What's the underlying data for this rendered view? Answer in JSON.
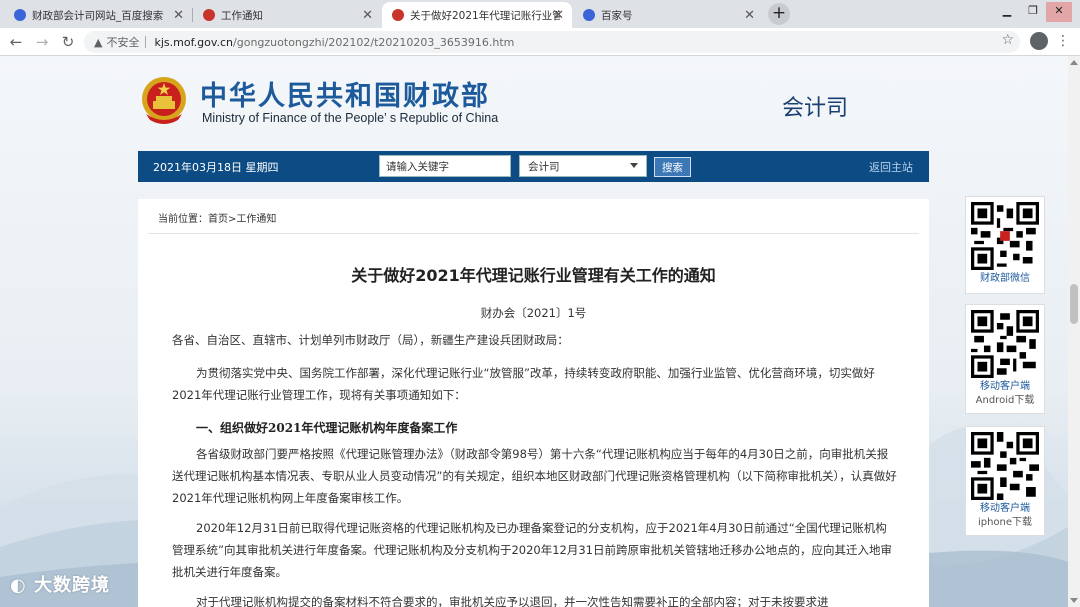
{
  "browser": {
    "tabs": [
      {
        "title": "财政部会计司网站_百度搜索",
        "active": false
      },
      {
        "title": "工作通知",
        "active": false
      },
      {
        "title": "关于做好2021年代理记账行业管",
        "active": true
      },
      {
        "title": "百家号",
        "active": false
      }
    ],
    "new_tab": "+",
    "security_label": "不安全",
    "url_host": "kjs.mof.gov.cn",
    "url_path": "/gongzuotongzhi/202102/t20210203_3653916.htm"
  },
  "site": {
    "name_cn": "中华人民共和国财政部",
    "name_en": "Ministry of Finance of the People’ s Republic of China",
    "dept": "会计司"
  },
  "toolbar": {
    "date": "2021年03月18日  星期四",
    "search_placeholder": "请输入关键字",
    "scope": "会计司",
    "search_button": "搜索",
    "back_home": "返回主站"
  },
  "article": {
    "breadcrumb": "当前位置：首页>工作通知",
    "title": "关于做好2021年代理记账行业管理有关工作的通知",
    "doc_no": "财办会〔2021〕1号",
    "salutation": "各省、自治区、直辖市、计划单列市财政厅（局），新疆生产建设兵团财政局：",
    "p1": "为贯彻落实党中央、国务院工作部署，深化代理记账行业“放管服”改革，持续转变政府职能、加强行业监管、优化营商环境，切实做好2021年代理记账行业管理工作，现将有关事项通知如下：",
    "h1": "一、组织做好2021年代理记账机构年度备案工作",
    "p2": "各省级财政部门要严格按照《代理记账管理办法》（财政部令第98号）第十六条“代理记账机构应当于每年的4月30日之前，向审批机关报送代理记账机构基本情况表、专职从业人员变动情况”的有关规定，组织本地区财政部门代理记账资格管理机构（以下简称审批机关），认真做好2021年代理记账机构网上年度备案审核工作。",
    "p3": "2020年12月31日前已取得代理记账资格的代理记账机构及已办理备案登记的分支机构，应于2021年4月30日前通过“全国代理记账机构管理系统”向其审批机关进行年度备案。代理记账机构及分支机构于2020年12月31日前跨原审批机关管辖地迁移办公地点的，应向其迁入地审批机关进行年度备案。",
    "p4": "对于代理记账机构提交的备案材料不符合要求的，审批机关应予以退回，并一次性告知需要补正的全部内容；对于未按要求进"
  },
  "sidebar": {
    "qr_cards": [
      {
        "label": "财政部微信",
        "sub": ""
      },
      {
        "label": "移动客户端",
        "sub": "Android下载"
      },
      {
        "label": "移动客户端",
        "sub": "iphone下载"
      }
    ]
  },
  "watermark": "大数跨境",
  "colors": {
    "brand_blue": "#0c4b84",
    "title_blue": "#1d5a9c"
  }
}
